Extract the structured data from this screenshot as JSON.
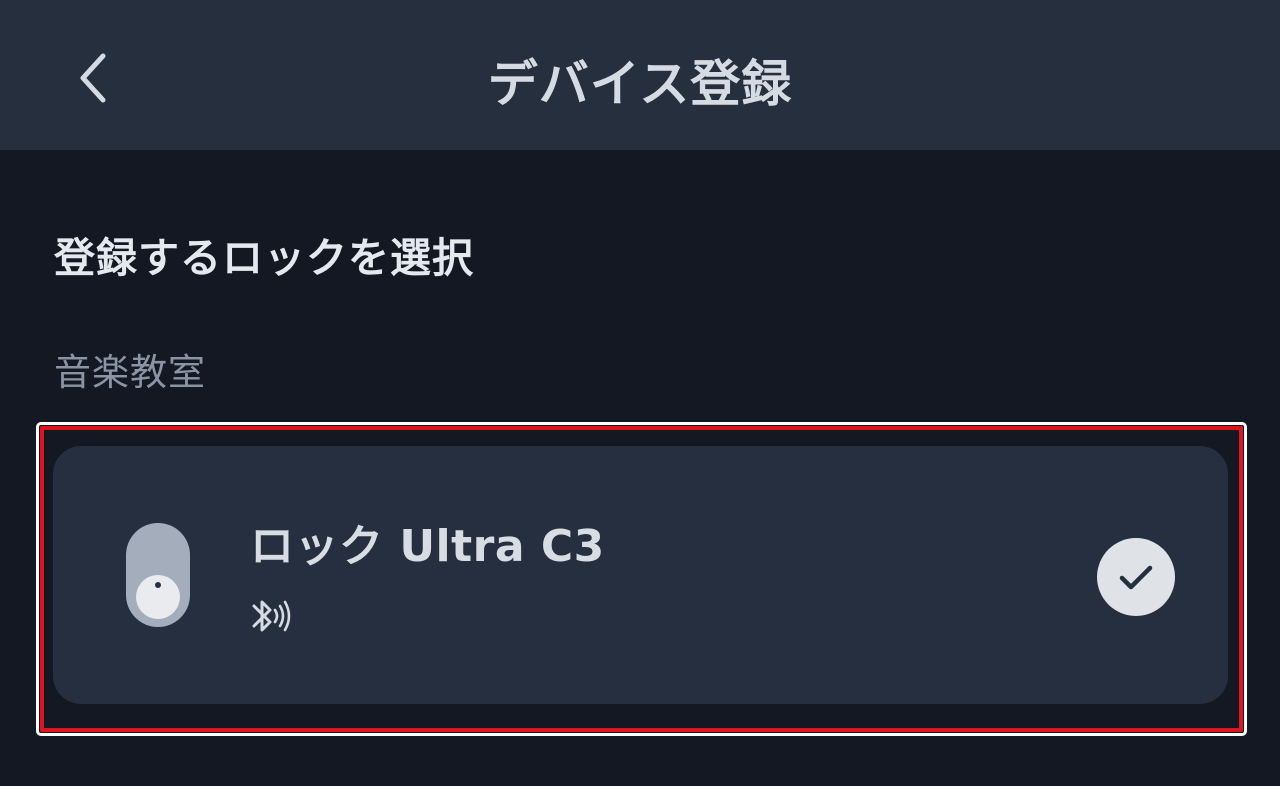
{
  "header": {
    "title": "デバイス登録",
    "back_icon": "chevron-left-icon"
  },
  "section": {
    "heading": "登録するロックを選択"
  },
  "group": {
    "label": "音楽教室"
  },
  "device_list": [
    {
      "name": "ロック Ultra C3",
      "device_icon": "smart-lock-icon",
      "connection_icon": "bluetooth-signal-icon",
      "selected": true,
      "selection_icon": "check-icon"
    }
  ],
  "colors": {
    "background": "#131823",
    "header": "#252f3e",
    "card": "#262f3f",
    "highlight_border": "#e0141e"
  }
}
